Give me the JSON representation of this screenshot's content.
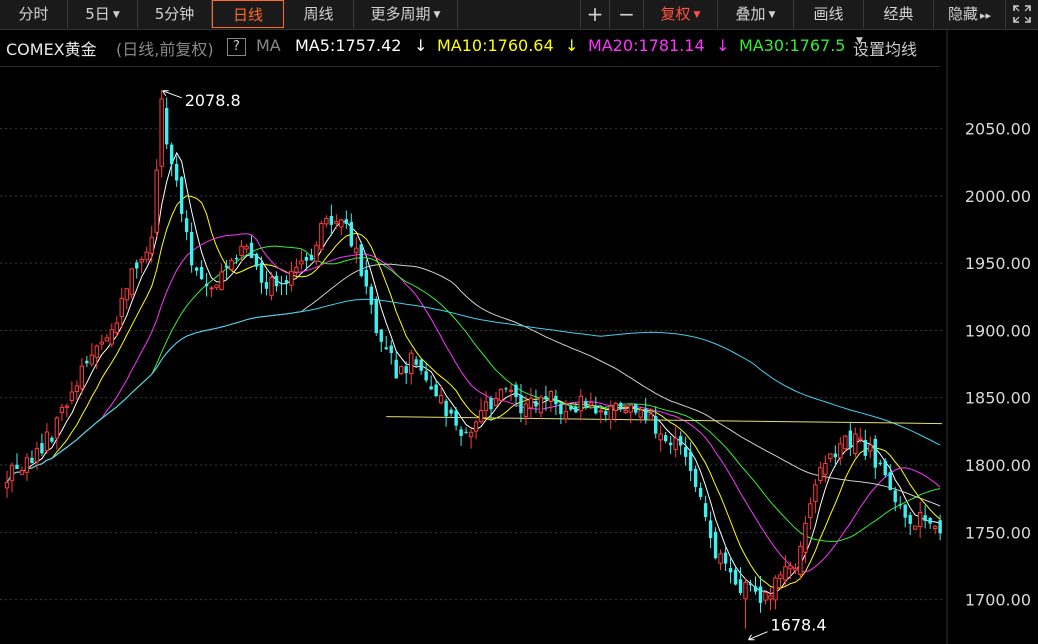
{
  "toolbar": {
    "tabs": [
      {
        "label": "分时",
        "name": "tab-intraday"
      },
      {
        "label": "5日",
        "name": "tab-5day",
        "dropdown": true
      },
      {
        "label": "5分钟",
        "name": "tab-5min"
      },
      {
        "label": "日线",
        "name": "tab-daily",
        "active": true
      },
      {
        "label": "周线",
        "name": "tab-weekly"
      },
      {
        "label": "更多周期",
        "name": "tab-more-periods",
        "dropdown": true
      }
    ],
    "zoom_in": "+",
    "zoom_out": "−",
    "adjust_label": "复权",
    "overlay_label": "叠加",
    "draw_label": "画线",
    "classic_label": "经典",
    "hide_label": "隐藏",
    "hide_arrow": "▸▸",
    "fullscreen_icon": "fullscreen-icon"
  },
  "legend": {
    "symbol": "COMEX黄金",
    "mode": "(日线,前复权)",
    "help": "?",
    "ma_label": "MA",
    "ma5": "MA5:1757.42",
    "ma10": "MA10:1760.64",
    "ma20": "MA20:1781.14",
    "ma30": "MA30:1767.5",
    "settings": "设置均线",
    "down_arrow": "↓",
    "colors": {
      "ma5": "#ffffff",
      "ma10": "#ffff00",
      "ma20": "#ff33ff",
      "ma30": "#33ee33",
      "ma60": "#cfcfcf",
      "ma120": "#3fd0f0",
      "ref": "#e6e070"
    }
  },
  "chart_data": {
    "type": "candlestick",
    "ylim": [
      1670,
      2095
    ],
    "yticks": [
      1700,
      1750,
      1800,
      1850,
      1900,
      1950,
      2000,
      2050
    ],
    "ytick_labels": [
      "1700.00",
      "1750.00",
      "1800.00",
      "1850.00",
      "1900.00",
      "1950.00",
      "2000.00",
      "2050.00"
    ],
    "up_color": "#ff3b3b",
    "down_color": "#3ff0f0",
    "annotations": [
      {
        "text": "2078.8",
        "value": 2078.8,
        "bar_index": 31
      },
      {
        "text": "1678.4",
        "value": 1678.4,
        "bar_index": 148
      }
    ],
    "horizontal_line": {
      "value": 1836,
      "from_index": 76
    },
    "keypoints": [
      [
        0,
        1794
      ],
      [
        6,
        1806
      ],
      [
        10,
        1830
      ],
      [
        14,
        1865
      ],
      [
        18,
        1887
      ],
      [
        22,
        1910
      ],
      [
        26,
        1950
      ],
      [
        29,
        1970
      ],
      [
        31,
        2065
      ],
      [
        34,
        2005
      ],
      [
        37,
        1955
      ],
      [
        40,
        1930
      ],
      [
        44,
        1945
      ],
      [
        48,
        1960
      ],
      [
        52,
        1935
      ],
      [
        56,
        1938
      ],
      [
        60,
        1950
      ],
      [
        64,
        1985
      ],
      [
        67,
        1985
      ],
      [
        70,
        1955
      ],
      [
        74,
        1900
      ],
      [
        78,
        1870
      ],
      [
        82,
        1880
      ],
      [
        86,
        1855
      ],
      [
        90,
        1830
      ],
      [
        93,
        1823
      ],
      [
        96,
        1845
      ],
      [
        100,
        1855
      ],
      [
        104,
        1842
      ],
      [
        108,
        1850
      ],
      [
        112,
        1843
      ],
      [
        116,
        1845
      ],
      [
        120,
        1838
      ],
      [
        124,
        1845
      ],
      [
        128,
        1835
      ],
      [
        132,
        1823
      ],
      [
        136,
        1810
      ],
      [
        139,
        1772
      ],
      [
        142,
        1733
      ],
      [
        146,
        1715
      ],
      [
        150,
        1700
      ],
      [
        154,
        1712
      ],
      [
        158,
        1730
      ],
      [
        162,
        1785
      ],
      [
        166,
        1812
      ],
      [
        170,
        1818
      ],
      [
        173,
        1808
      ],
      [
        176,
        1790
      ],
      [
        180,
        1758
      ],
      [
        184,
        1762
      ],
      [
        186,
        1750
      ]
    ]
  }
}
